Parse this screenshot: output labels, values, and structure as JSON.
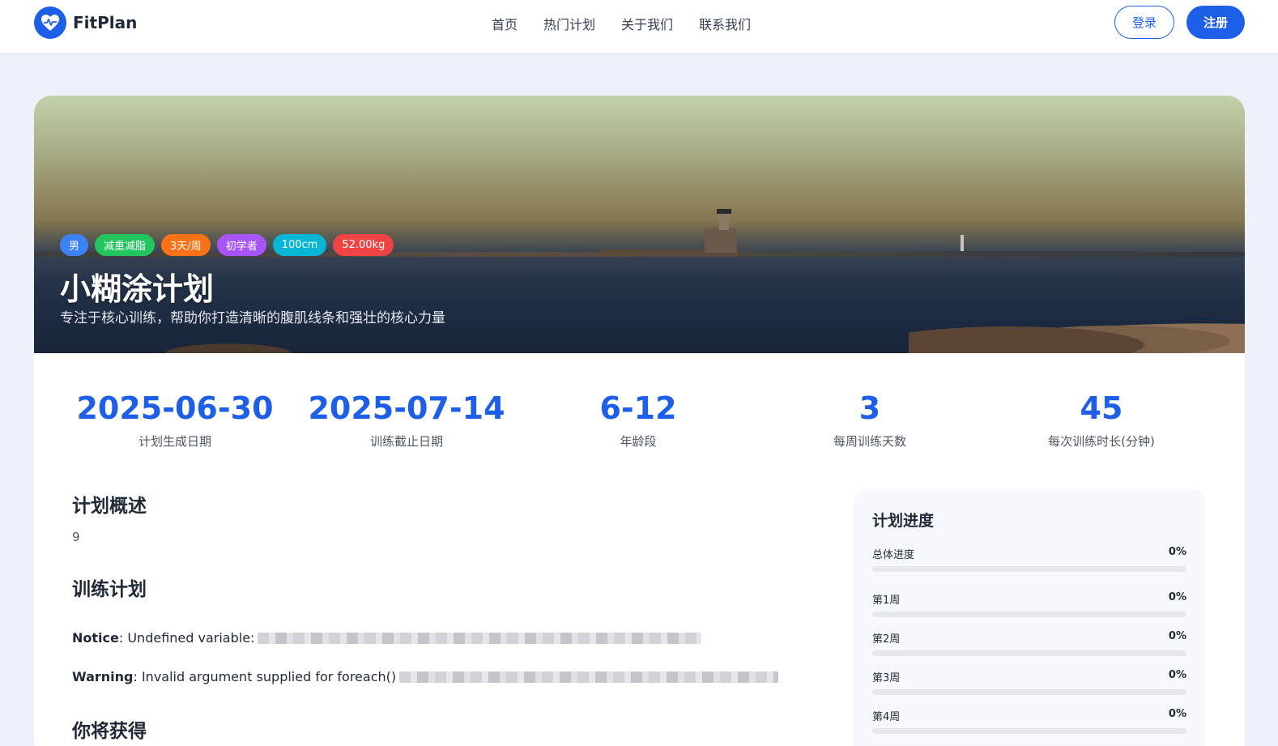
{
  "header": {
    "brand": "FitPlan",
    "nav": [
      "首页",
      "热门计划",
      "关于我们",
      "联系我们"
    ],
    "login": "登录",
    "register": "注册"
  },
  "hero": {
    "tags": [
      {
        "label": "男",
        "color": "#3b82f6"
      },
      {
        "label": "减重减脂",
        "color": "#22c55e"
      },
      {
        "label": "3天/周",
        "color": "#f97316"
      },
      {
        "label": "初学者",
        "color": "#a855f7"
      },
      {
        "label": "100cm",
        "color": "#06b6d4"
      },
      {
        "label": "52.00kg",
        "color": "#ef4444"
      }
    ],
    "title": "小糊涂计划",
    "subtitle": "专注于核心训练，帮助你打造清晰的腹肌线条和强壮的核心力量"
  },
  "stats": [
    {
      "value": "2025-06-30",
      "label": "计划生成日期"
    },
    {
      "value": "2025-07-14",
      "label": "训练截止日期"
    },
    {
      "value": "6-12",
      "label": "年龄段"
    },
    {
      "value": "3",
      "label": "每周训练天数"
    },
    {
      "value": "45",
      "label": "每次训练时长(分钟)"
    }
  ],
  "overview": {
    "title": "计划概述",
    "text": "9"
  },
  "training": {
    "title": "训练计划",
    "notice_label": "Notice",
    "notice_text": ": Undefined variable:",
    "warning_label": "Warning",
    "warning_text": ": Invalid argument supplied for foreach()"
  },
  "gain": {
    "title": "你将获得"
  },
  "progress": {
    "title": "计划进度",
    "rows": [
      {
        "label": "总体进度",
        "percent_text": "0%",
        "value": 0
      },
      {
        "label": "第1周",
        "percent_text": "0%",
        "value": 0
      },
      {
        "label": "第2周",
        "percent_text": "0%",
        "value": 0
      },
      {
        "label": "第3周",
        "percent_text": "0%",
        "value": 0
      },
      {
        "label": "第4周",
        "percent_text": "0%",
        "value": 0
      }
    ]
  },
  "colors": {
    "accent": "#1e5fe8"
  }
}
